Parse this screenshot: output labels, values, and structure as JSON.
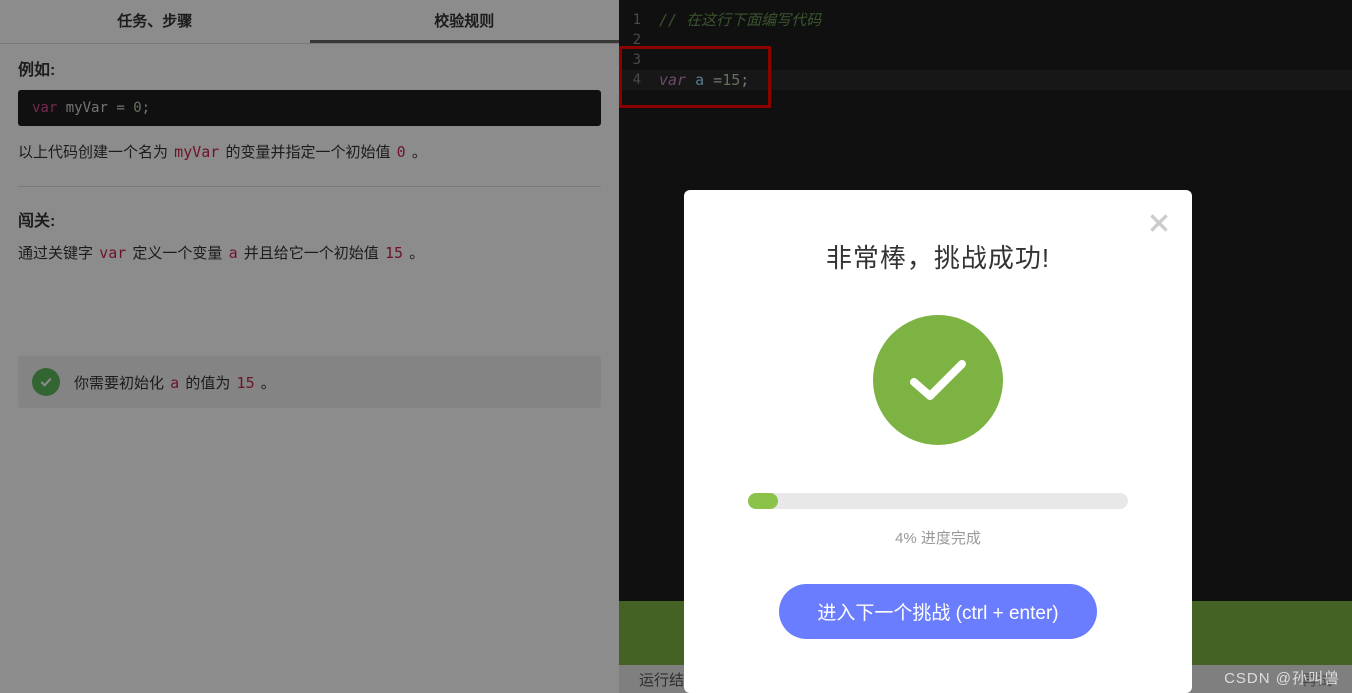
{
  "tabs": {
    "task": "任务、步骤",
    "validation": "校验规则"
  },
  "example": {
    "title": "例如:",
    "code": {
      "var": "var",
      "id": "myVar",
      "eq": " = ",
      "num": "0",
      "semi": ";"
    },
    "desc_pre": "以上代码创建一个名为 ",
    "desc_code": "myVar",
    "desc_mid": " 的变量并指定一个初始值 ",
    "desc_val": "0",
    "desc_end": " 。"
  },
  "challenge": {
    "title": "闯关:",
    "line_pre": "通过关键字 ",
    "kw_var": "var",
    "line_mid1": " 定义一个变量 ",
    "kw_a": "a",
    "line_mid2": " 并且给它一个初始值 ",
    "kw_15": "15",
    "line_end": " 。"
  },
  "result": {
    "pre": "你需要初始化 ",
    "var_a": "a",
    "mid": " 的值为 ",
    "val": "15",
    "end": " 。"
  },
  "editor": {
    "lines": [
      {
        "n": "1",
        "type": "comment",
        "text": "// 在这行下面编写代码"
      },
      {
        "n": "2",
        "type": "blank",
        "text": ""
      },
      {
        "n": "3",
        "type": "blank",
        "text": ""
      },
      {
        "n": "4",
        "type": "code",
        "var": "var",
        "id": "a",
        "op": " =",
        "num": "15",
        "semi": ";"
      }
    ]
  },
  "bottom": {
    "left": "运行结",
    "right": "再试"
  },
  "modal": {
    "title": "非常棒，挑战成功!",
    "progress_pct": "4%",
    "progress_label": " 进度完成",
    "next_btn": "进入下一个挑战 (ctrl + enter)"
  },
  "watermark": "CSDN @孙叫兽"
}
